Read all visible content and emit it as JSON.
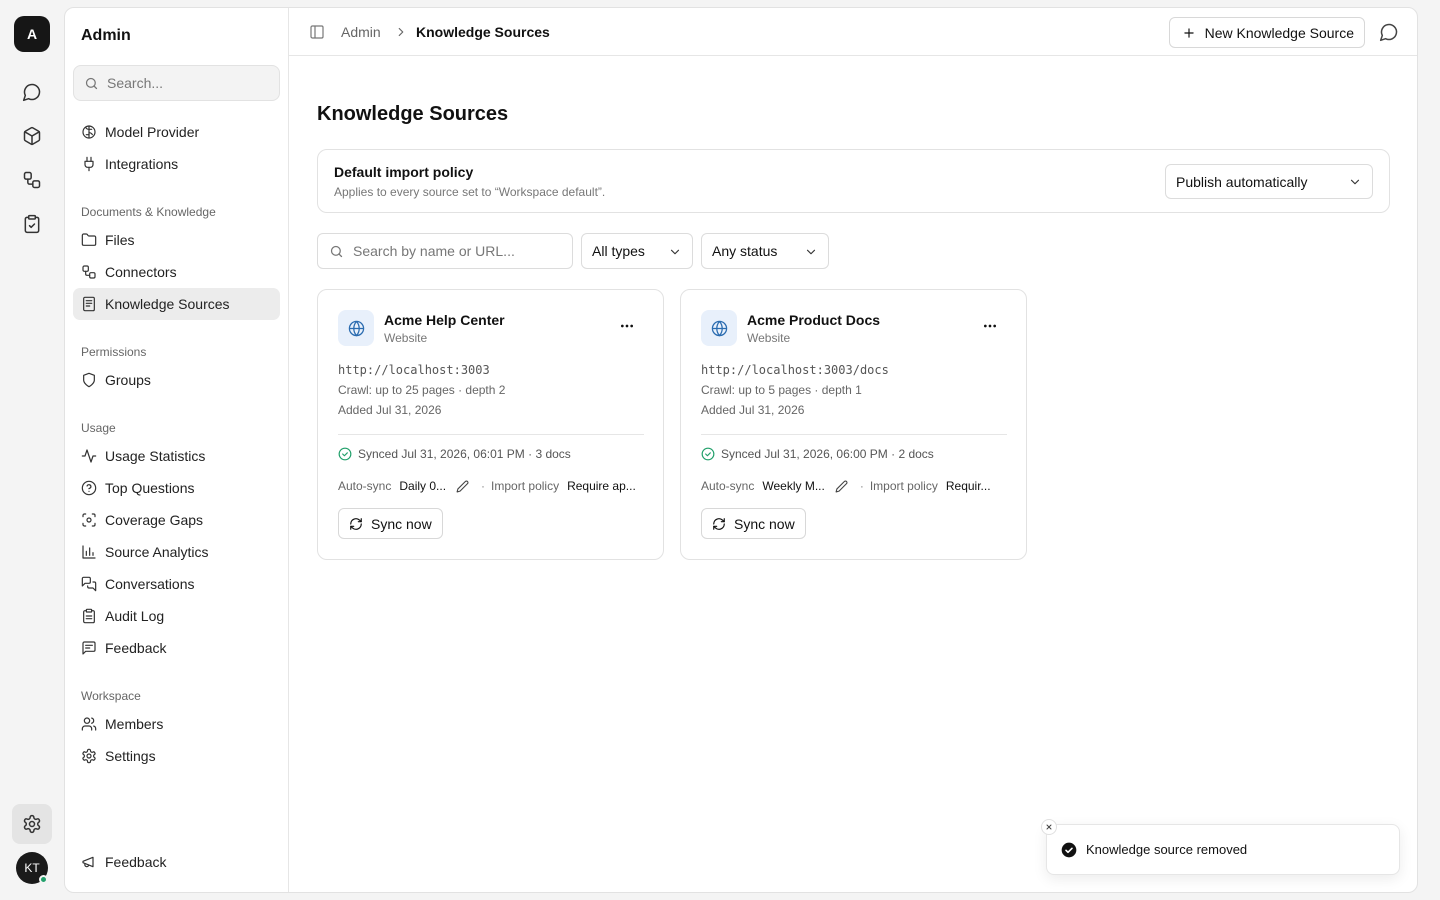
{
  "rail": {
    "logo_letter": "A",
    "avatar_initials": "KT"
  },
  "sidebar": {
    "title": "Admin",
    "search_placeholder": "Search...",
    "top_items": [
      {
        "label": "Model Provider",
        "icon": "brain-icon"
      },
      {
        "label": "Integrations",
        "icon": "plug-icon"
      }
    ],
    "sections": [
      {
        "title": "Documents & Knowledge",
        "items": [
          {
            "label": "Files",
            "icon": "folder-icon"
          },
          {
            "label": "Connectors",
            "icon": "connector-icon"
          },
          {
            "label": "Knowledge Sources",
            "icon": "document-icon",
            "active": true
          }
        ]
      },
      {
        "title": "Permissions",
        "items": [
          {
            "label": "Groups",
            "icon": "shield-icon"
          }
        ]
      },
      {
        "title": "Usage",
        "items": [
          {
            "label": "Usage Statistics",
            "icon": "activity-icon"
          },
          {
            "label": "Top Questions",
            "icon": "question-icon"
          },
          {
            "label": "Coverage Gaps",
            "icon": "scan-icon"
          },
          {
            "label": "Source Analytics",
            "icon": "bar-chart-icon"
          },
          {
            "label": "Conversations",
            "icon": "chats-icon"
          },
          {
            "label": "Audit Log",
            "icon": "clipboard-icon"
          },
          {
            "label": "Feedback",
            "icon": "message-icon"
          }
        ]
      },
      {
        "title": "Workspace",
        "items": [
          {
            "label": "Members",
            "icon": "users-icon"
          },
          {
            "label": "Settings",
            "icon": "gear-icon"
          }
        ]
      }
    ],
    "bottom_item": {
      "label": "Feedback",
      "icon": "megaphone-icon"
    }
  },
  "header": {
    "crumb_root": "Admin",
    "crumb_current": "Knowledge Sources",
    "new_button": "New Knowledge Source"
  },
  "main": {
    "title": "Knowledge Sources",
    "policy": {
      "title": "Default import policy",
      "subtitle": "Applies to every source set to “Workspace default”.",
      "selected": "Publish automatically"
    },
    "filters": {
      "search_placeholder": "Search by name or URL...",
      "type_selected": "All types",
      "status_selected": "Any status"
    },
    "cards": [
      {
        "name": "Acme Help Center",
        "type": "Website",
        "url": "http://localhost:3003",
        "crawl": "Crawl: up to 25 pages · depth 2",
        "added": "Added Jul 31, 2026",
        "synced": "Synced Jul 31, 2026, 06:01 PM · 3 docs",
        "autosync_label": "Auto-sync",
        "autosync_value": "Daily 0...",
        "sep": "·",
        "policy_label": "Import policy",
        "policy_value": "Require ap...",
        "sync_button": "Sync now"
      },
      {
        "name": "Acme Product Docs",
        "type": "Website",
        "url": "http://localhost:3003/docs",
        "crawl": "Crawl: up to 5 pages · depth 1",
        "added": "Added Jul 31, 2026",
        "synced": "Synced Jul 31, 2026, 06:00 PM · 2 docs",
        "autosync_label": "Auto-sync",
        "autosync_value": "Weekly M...",
        "sep": "·",
        "policy_label": "Import policy",
        "policy_value": "Requir...",
        "sync_button": "Sync now"
      }
    ]
  },
  "toast": {
    "message": "Knowledge source removed"
  }
}
